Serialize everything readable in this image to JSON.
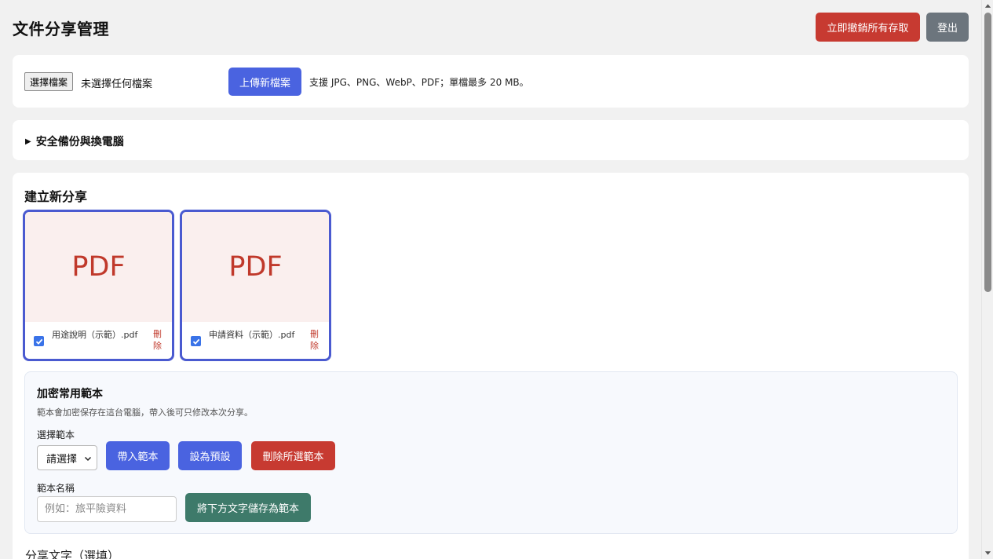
{
  "header": {
    "title": "文件分享管理",
    "revoke_label": "立即撤銷所有存取",
    "logout_label": "登出"
  },
  "upload": {
    "choose_label": "選擇檔案",
    "no_file_text": "未選擇任何檔案",
    "upload_label": "上傳新檔案",
    "hint": "支援 JPG、PNG、WebP、PDF；單檔最多 20 MB。"
  },
  "backup": {
    "summary": "安全備份與換電腦"
  },
  "share": {
    "title": "建立新分享",
    "files": [
      {
        "preview": "PDF",
        "name": "用途說明（示範）.pdf",
        "checked": true,
        "delete_label": "刪除"
      },
      {
        "preview": "PDF",
        "name": "申請資料（示範）.pdf",
        "checked": true,
        "delete_label": "刪除"
      }
    ],
    "templates": {
      "title": "加密常用範本",
      "desc": "範本會加密保存在這台電腦，帶入後可只修改本次分享。",
      "select_label": "選擇範本",
      "select_value": "請選擇",
      "load_label": "帶入範本",
      "default_label": "設為預設",
      "delete_label": "刪除所選範本",
      "name_label": "範本名稱",
      "name_placeholder": "例如：旅平險資料",
      "save_label": "將下方文字儲存為範本"
    },
    "share_text_label": "分享文字（選填）"
  },
  "colors": {
    "primary": "#4a63e0",
    "danger": "#c73a31",
    "secondary": "#6c757d",
    "save": "#3e7a6a"
  }
}
